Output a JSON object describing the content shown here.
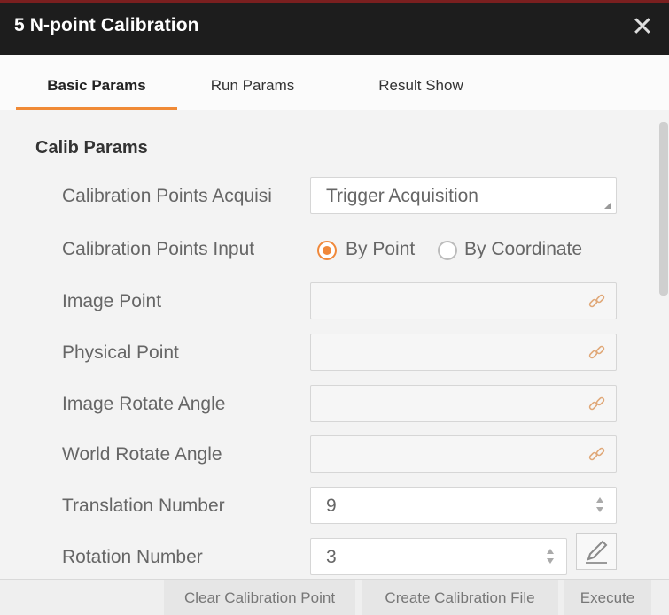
{
  "window": {
    "title": "5 N-point Calibration",
    "close_glyph": "✕"
  },
  "tabs": [
    {
      "label": "Basic Params",
      "active": true
    },
    {
      "label": "Run Params",
      "active": false
    },
    {
      "label": "Result Show",
      "active": false
    }
  ],
  "section": {
    "title": "Calib Params"
  },
  "params": {
    "acquisition": {
      "label": "Calibration Points Acquisi",
      "value": "Trigger Acquisition"
    },
    "input_mode": {
      "label": "Calibration Points Input",
      "options": [
        {
          "label": "By Point",
          "selected": true
        },
        {
          "label": "By Coordinate",
          "selected": false
        }
      ]
    },
    "image_point": {
      "label": "Image Point",
      "value": ""
    },
    "physical_point": {
      "label": "Physical Point",
      "value": ""
    },
    "image_rotate_angle": {
      "label": "Image Rotate Angle",
      "value": ""
    },
    "world_rotate_angle": {
      "label": "World Rotate Angle",
      "value": ""
    },
    "translation_number": {
      "label": "Translation Number",
      "value": "9"
    },
    "rotation_number": {
      "label": "Rotation Number",
      "value": "3"
    }
  },
  "footer": {
    "clear_label": "Clear Calibration Point",
    "create_label": "Create Calibration File",
    "execute_label": "Execute"
  },
  "icons": {
    "link": "link-icon",
    "edit": "pencil-icon"
  },
  "colors": {
    "titlebar": "#1d1d1d",
    "accent": "#f08a36"
  }
}
